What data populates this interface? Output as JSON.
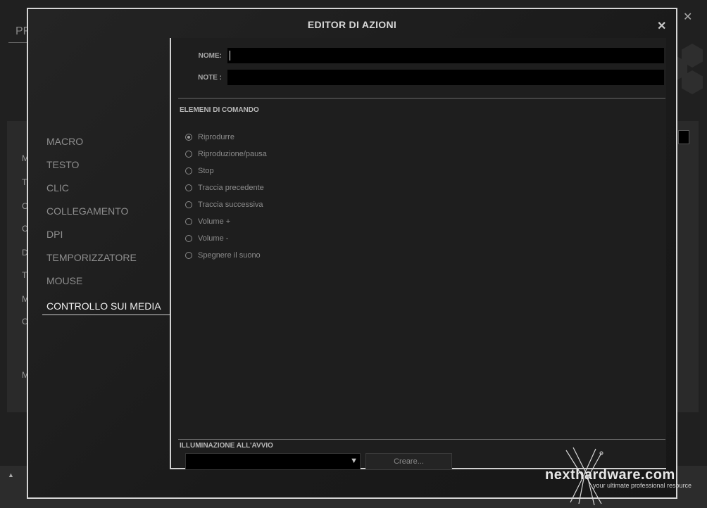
{
  "background": {
    "title_fragment": "PF",
    "side_letters": [
      "M",
      "T",
      "C",
      "C",
      "D",
      "T",
      "M",
      "C",
      "M"
    ]
  },
  "dialog": {
    "title": "EDITOR DI AZIONI",
    "close_glyph": "✕"
  },
  "nav": {
    "items": [
      {
        "label": "MACRO"
      },
      {
        "label": "TESTO"
      },
      {
        "label": "CLIC"
      },
      {
        "label": "COLLEGAMENTO"
      },
      {
        "label": "DPI"
      },
      {
        "label": "TEMPORIZZATORE"
      },
      {
        "label": "MOUSE"
      },
      {
        "label": "CONTROLLO SUI MEDIA"
      }
    ],
    "active_index": 7
  },
  "form": {
    "name_label": "NOME:",
    "name_value": "",
    "note_label": "NOTE :",
    "note_value": ""
  },
  "command_elements": {
    "heading": "ELEMENI DI COMANDO",
    "options": [
      {
        "label": "Riprodurre",
        "checked": true
      },
      {
        "label": "Riproduzione/pausa",
        "checked": false
      },
      {
        "label": "Stop",
        "checked": false
      },
      {
        "label": "Traccia precedente",
        "checked": false
      },
      {
        "label": "Traccia successiva",
        "checked": false
      },
      {
        "label": "Volume +",
        "checked": false
      },
      {
        "label": "Volume -",
        "checked": false
      },
      {
        "label": "Spegnere il suono",
        "checked": false
      }
    ]
  },
  "startup_lighting": {
    "heading": "ILLUMINAZIONE ALL'AVVIO",
    "selected_value": "",
    "create_label": "Creare..."
  },
  "watermark": {
    "brand": "nexthardware.com",
    "tagline": "your ultimate professional resource"
  },
  "colors": {
    "dialog_border": "#d5d5d5",
    "background": "#1c1c1c",
    "input_bg": "#000000"
  }
}
